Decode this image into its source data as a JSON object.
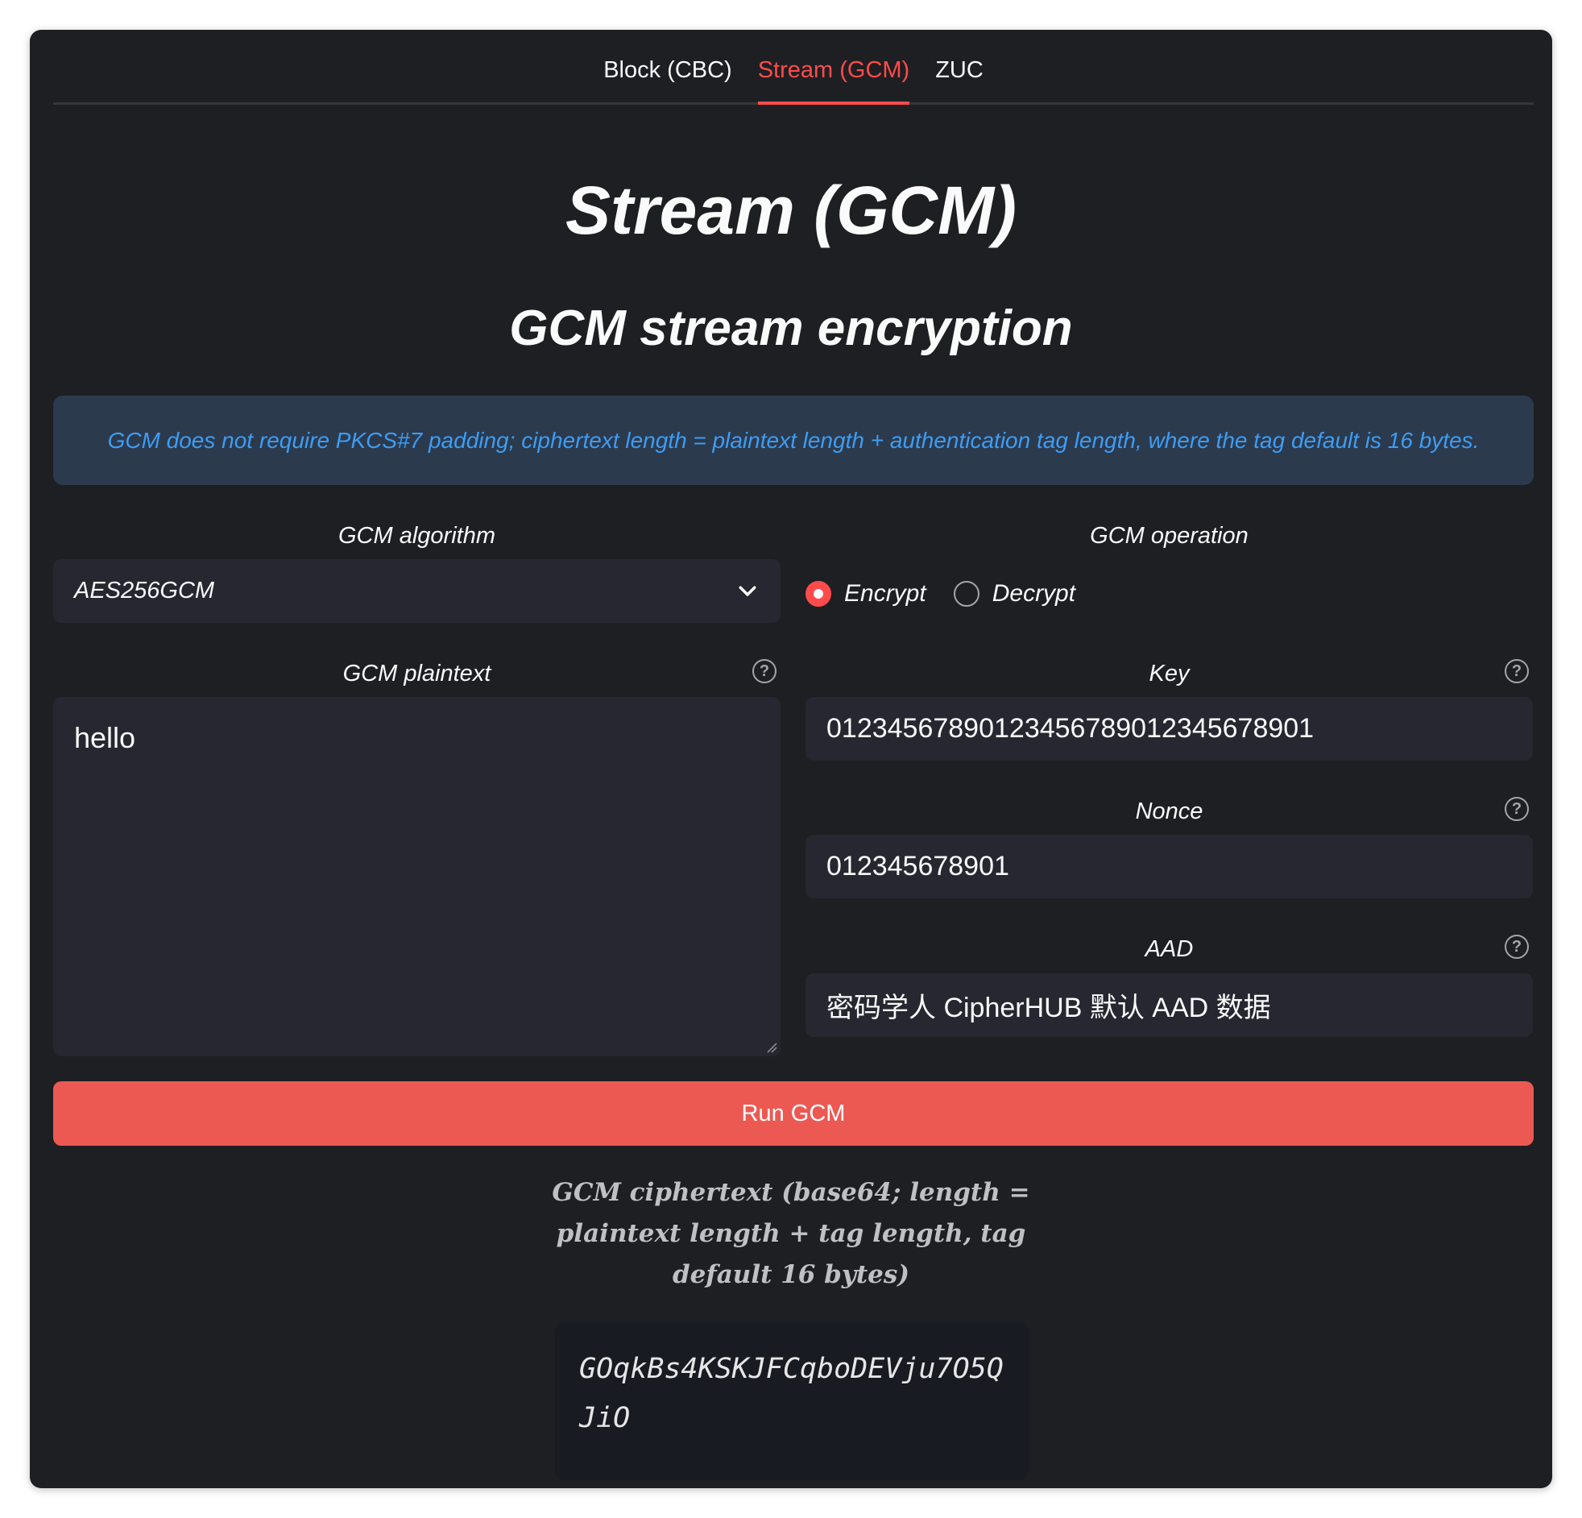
{
  "tabs": [
    {
      "label": "Block (CBC)",
      "active": false
    },
    {
      "label": "Stream (GCM)",
      "active": true
    },
    {
      "label": "ZUC",
      "active": false
    }
  ],
  "page": {
    "title": "Stream (GCM)",
    "subtitle": "GCM stream encryption",
    "info": "GCM does not require PKCS#7 padding; ciphertext length = plaintext length + authentication tag length, where the tag default is 16 bytes."
  },
  "algorithm": {
    "label": "GCM algorithm",
    "value": "AES256GCM"
  },
  "operation": {
    "label": "GCM operation",
    "options": [
      {
        "label": "Encrypt",
        "selected": true
      },
      {
        "label": "Decrypt",
        "selected": false
      }
    ]
  },
  "plaintext": {
    "label": "GCM plaintext",
    "value": "hello"
  },
  "key": {
    "label": "Key",
    "value": "01234567890123456789012345678901"
  },
  "nonce": {
    "label": "Nonce",
    "value": "012345678901"
  },
  "aad": {
    "label": "AAD",
    "value": "密码学人 CipherHUB 默认 AAD 数据"
  },
  "run_button": {
    "label": "Run GCM"
  },
  "output": {
    "label": "GCM ciphertext (base64; length = plaintext length + tag length, tag default 16 bytes)",
    "value": "GOqkBs4KSKJFCqboDEVju7O5QJiO"
  },
  "colors": {
    "accent": "#ff4b4b",
    "button": "#ec5953",
    "info_bg": "#2c3a4e",
    "info_text": "#3d9df3",
    "background": "#1e1f22",
    "input_bg": "#262730"
  },
  "icons": [
    "chevron-down-icon",
    "help-icon",
    "resize-grip-icon"
  ]
}
